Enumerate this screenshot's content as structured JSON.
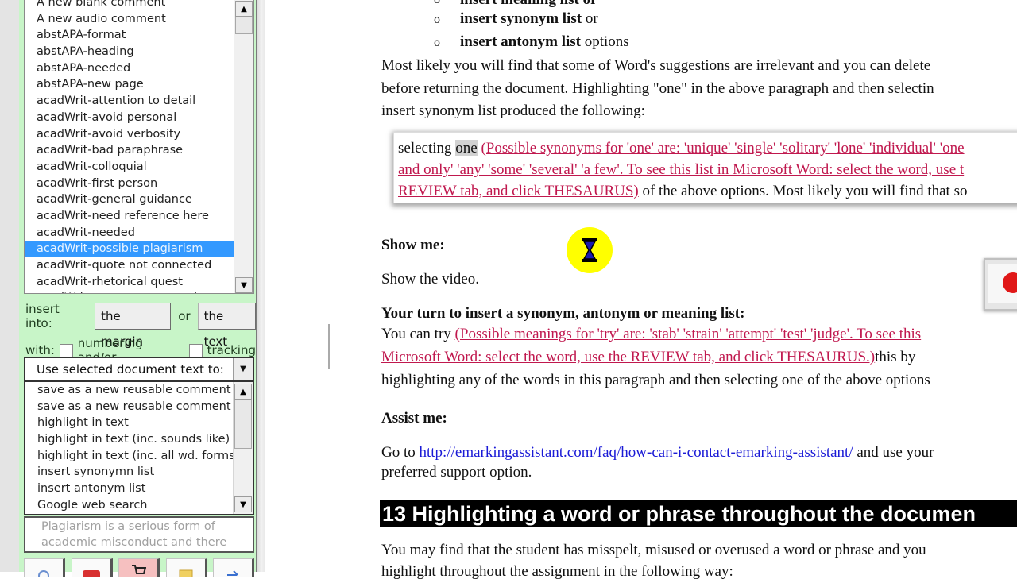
{
  "sidebar": {
    "comment_list": {
      "items": [
        "A new blank comment",
        "A new audio comment",
        "abstAPA-format",
        "abstAPA-heading",
        "abstAPA-needed",
        "abstAPA-new page",
        "acadWrit-attention to detail",
        "acadWrit-avoid personal",
        "acadWrit-avoid verbosity",
        "acadWrit-bad paraphrase",
        "acadWrit-colloquial",
        "acadWrit-first person",
        "acadWrit-general guidance",
        "acadWrit-need reference here",
        "acadWrit-needed",
        "acadWrit-possible plagiarism",
        "acadWrit-quote not connected",
        "acadWrit-rhetorical quest",
        "acadWrit-use more expression"
      ],
      "selected": "acadWrit-possible plagiarism"
    },
    "insert_into_label": "insert into:",
    "margin_button": "the margin",
    "or_label": "or",
    "text_button": "the text",
    "with_label": "with:",
    "numbering_label": "numbering and/or",
    "tracking_label": "tracking",
    "numbering_checked": false,
    "tracking_checked": false,
    "selected_text_dropdown": "Use selected document text to:",
    "action_list": {
      "items": [
        "save as a new reusable comment",
        "save as a new reusable comment",
        "highlight in text",
        "highlight in text (inc. sounds like)",
        "highlight in text (inc. all wd. forms",
        "insert synonymn list",
        "insert antonym list",
        "Google web search"
      ]
    },
    "preview_text_line1": "Plagiarism is a serious form of",
    "preview_text_line2": "academic misconduct and there",
    "toolbar_icons": [
      "search-icon",
      "youtube-icon",
      "cart-icon",
      "note-icon",
      "arrow-icon"
    ]
  },
  "document": {
    "bullet1_bold": "insert meaning list or",
    "bullet2_bold": "insert synonym list",
    "bullet2_rest": " or",
    "bullet3_bold": "insert antonym list",
    "bullet3_rest": " options",
    "bullet_glyph": "o",
    "para1_line1": "Most likely you will find that some of Word's suggestions are irrelevant and you can delete",
    "para1_line2": "before returning the document. Highlighting \"one\" in the above paragraph and then selectin",
    "para1_line3": "insert synonym list produced the following:",
    "callout": {
      "prefix": "selecting ",
      "highlighted": "one",
      "ref_line1": "(Possible synonyms for 'one' are: 'unique' 'single' 'solitary' 'lone' 'individual' 'one",
      "ref_line2": "and only' 'any' 'some' 'several' 'a few'. To see this list in Microsoft Word: select the word, use t",
      "ref_line3": "REVIEW tab, and click THESAURUS)",
      "suffix": " of the above options. Most likely you will find that so"
    },
    "show_me_heading": "Show me:",
    "show_video": "Show the video.",
    "your_turn_heading": "Your turn to insert a synonym, antonym or meaning list:",
    "your_turn_prefix": "You can try ",
    "your_turn_ref1": " (Possible meanings for 'try' are: 'stab' 'strain' 'attempt' 'test' 'judge'. To see this",
    "your_turn_ref2": "Microsoft Word: select the word, use the REVIEW tab, and click THESAURUS.)",
    "your_turn_suffix": "this by",
    "your_turn_line3": "highlighting any of the words in this paragraph and then selecting one of the above options",
    "assist_heading": "Assist me:",
    "assist_prefix": "Go to ",
    "assist_link": "http://emarkingassistant.com/faq/how-can-i-contact-emarking-assistant/",
    "assist_suffix": " and use your",
    "assist_line2": "preferred support option.",
    "section13_heading": "13 Highlighting a word or phrase throughout the documen",
    "section13_line1": "You may find that the student has misspelt, misused or overused a word or phrase and you",
    "section13_line2": "highlight throughout the assignment in the following way:"
  },
  "colors": {
    "panel_bg": "#c8f5c8",
    "selection": "#3399ff",
    "reference_text": "#c0184e",
    "link": "#1a1ad6",
    "busy_cursor_bg": "#ffff00"
  }
}
